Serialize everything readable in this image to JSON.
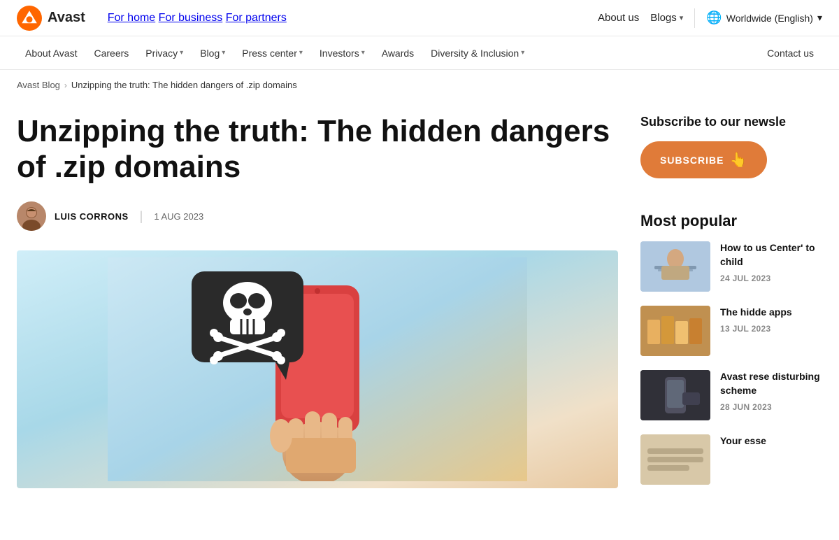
{
  "brand": {
    "name": "Avast"
  },
  "top_nav": {
    "primary_links": [
      {
        "label": "For home",
        "href": "#"
      },
      {
        "label": "For business",
        "href": "#"
      },
      {
        "label": "For partners",
        "href": "#"
      }
    ],
    "about_label": "About us",
    "blogs_label": "Blogs",
    "lang_label": "Worldwide (English)"
  },
  "sec_nav": {
    "links": [
      {
        "label": "About Avast",
        "has_dropdown": false
      },
      {
        "label": "Careers",
        "has_dropdown": false
      },
      {
        "label": "Privacy",
        "has_dropdown": true
      },
      {
        "label": "Blog",
        "has_dropdown": true
      },
      {
        "label": "Press center",
        "has_dropdown": true
      },
      {
        "label": "Investors",
        "has_dropdown": true
      },
      {
        "label": "Awards",
        "has_dropdown": false
      },
      {
        "label": "Diversity & Inclusion",
        "has_dropdown": true
      }
    ],
    "contact_label": "Contact us"
  },
  "breadcrumb": {
    "parent_label": "Avast Blog",
    "current_label": "Unzipping the truth: The hidden dangers of .zip domains"
  },
  "article": {
    "title": "Unzipping the truth: The hidden dangers of .zip domains",
    "author_name": "LUIS CORRONS",
    "date": "1 AUG 2023"
  },
  "sidebar": {
    "subscribe_title": "Subscribe to our newsle",
    "subscribe_btn_label": "SUBSCRIBE",
    "most_popular_title": "Most popular",
    "popular_items": [
      {
        "title": "How to us Center' to child",
        "date": "24 JUL 2023",
        "thumb_class": "thumb-1"
      },
      {
        "title": "The hidde apps",
        "date": "13 JUL 2023",
        "thumb_class": "thumb-2"
      },
      {
        "title": "Avast rese disturbing scheme",
        "date": "28 JUN 2023",
        "thumb_class": "thumb-3"
      },
      {
        "title": "Your esse",
        "date": "",
        "thumb_class": "thumb-4"
      }
    ]
  }
}
